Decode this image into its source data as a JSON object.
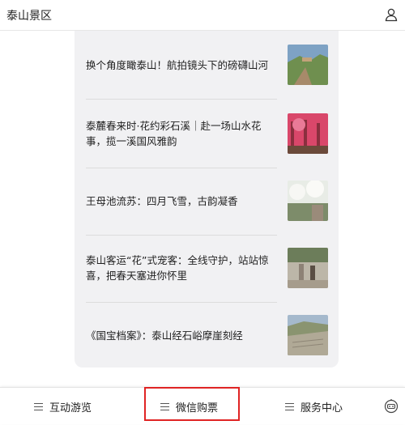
{
  "header": {
    "title": "泰山景区",
    "user_icon": "user-icon"
  },
  "articles": [
    {
      "title": "换个角度瞰泰山！航拍镜头下的磅礴山河",
      "thumb_colors": [
        "#7ea2c4",
        "#6f8f4f",
        "#a78a6a"
      ]
    },
    {
      "title": "泰麓春来时·花约彩石溪｜赴一场山水花事，揽一溪国风雅韵",
      "thumb_colors": [
        "#d9476a",
        "#8a2f3e",
        "#6b4a3a"
      ]
    },
    {
      "title": "王母池流苏：四月飞雪，古韵凝香",
      "thumb_colors": [
        "#e8ece6",
        "#7d8c6a",
        "#9a8b7a"
      ]
    },
    {
      "title": "泰山客运“花”式宠客：全线守护，站站惊喜，把春天塞进你怀里",
      "thumb_colors": [
        "#bcb6a8",
        "#6c7d5a",
        "#8d8276"
      ]
    },
    {
      "title": "《国宝档案》：泰山经石峪摩崖刻经",
      "thumb_colors": [
        "#a5b9cc",
        "#8a9470",
        "#b0a996"
      ]
    }
  ],
  "bottom_nav": {
    "tabs": [
      {
        "label": "互动游览"
      },
      {
        "label": "微信购票"
      },
      {
        "label": "服务中心"
      }
    ],
    "robot_icon": "robot-icon"
  },
  "colors": {
    "highlight": "#e02424",
    "card_bg": "#f1f1f3"
  }
}
